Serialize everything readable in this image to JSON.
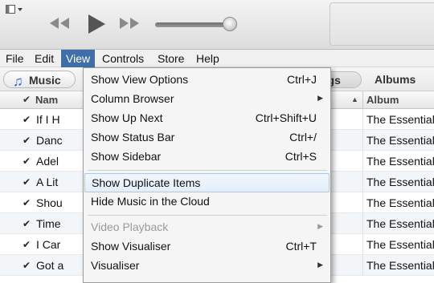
{
  "menubar": {
    "items": [
      {
        "label": "File"
      },
      {
        "label": "Edit"
      },
      {
        "label": "View"
      },
      {
        "label": "Controls"
      },
      {
        "label": "Store"
      },
      {
        "label": "Help"
      }
    ],
    "active": "View"
  },
  "player": {
    "icons": [
      "window-menu-icon",
      "previous-icon",
      "play-icon",
      "next-icon",
      "volume-slider"
    ],
    "volume_fraction": 0.92
  },
  "source": {
    "library_label": "Music",
    "tabs": [
      "ngs",
      "Albums"
    ]
  },
  "table": {
    "columns": [
      "Nam",
      "Album"
    ],
    "rows": [
      {
        "name": "If I H",
        "album": "The Essential"
      },
      {
        "name": "Danc",
        "album": "The Essential"
      },
      {
        "name": "Adel",
        "album": "The Essential"
      },
      {
        "name": "A Lit",
        "album": "The Essential"
      },
      {
        "name": "Shou",
        "album": "The Essential"
      },
      {
        "name": "Time",
        "album": "The Essential"
      },
      {
        "name": "I Car",
        "album": "The Essential"
      },
      {
        "name": "Got a",
        "album": "The Essential"
      }
    ]
  },
  "view_menu": {
    "items": [
      {
        "label": "Show View Options",
        "shortcut": "Ctrl+J"
      },
      {
        "label": "Column Browser",
        "shortcut": "",
        "submenu": true
      },
      {
        "label": "Show Up Next",
        "shortcut": "Ctrl+Shift+U"
      },
      {
        "label": "Show Status Bar",
        "shortcut": "Ctrl+/"
      },
      {
        "label": "Show Sidebar",
        "shortcut": "Ctrl+S"
      },
      {
        "label": "Show Duplicate Items",
        "shortcut": "",
        "highlighted": true
      },
      {
        "label": "Hide Music in the Cloud",
        "shortcut": ""
      },
      {
        "label": "Video Playback",
        "shortcut": "",
        "submenu": true,
        "disabled": true
      },
      {
        "label": "Show Visualiser",
        "shortcut": "Ctrl+T"
      },
      {
        "label": "Visualiser",
        "shortcut": "",
        "submenu": true
      }
    ]
  },
  "colors": {
    "menu_active_bg": "#3f6fa8",
    "highlight_border": "#a9c8ee",
    "music_icon": "#2b63c7"
  }
}
